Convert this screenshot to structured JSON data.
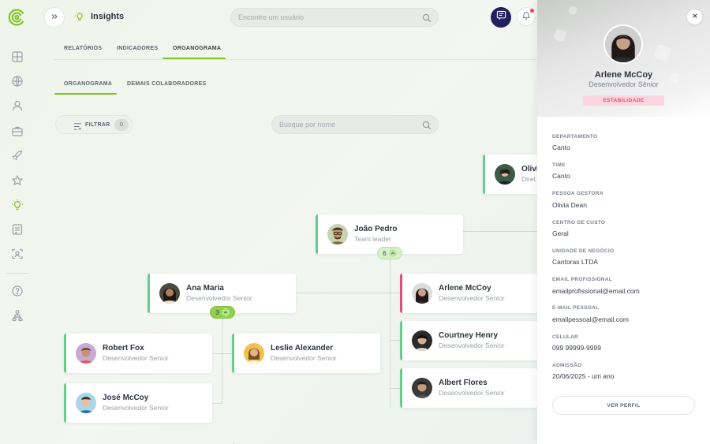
{
  "header": {
    "page_title": "Insights",
    "search_placeholder": "Encontre um usuário"
  },
  "tabs": [
    {
      "label": "RELATÓRIOS"
    },
    {
      "label": "INDICADORES"
    },
    {
      "label": "ORGANOGRAMA"
    }
  ],
  "subtabs": [
    {
      "label": "ORGANOGRAMA"
    },
    {
      "label": "DEMAIS COLABORADORES"
    }
  ],
  "filter": {
    "label": "FILTRAR",
    "count": "0"
  },
  "org_search": {
    "placeholder": "Busque por nome"
  },
  "org_chart": {
    "top": {
      "name": "Olivia",
      "role": "Diret"
    },
    "team_leader": {
      "name": "João Pedro",
      "role": "Team leader",
      "count": "6"
    },
    "ana": {
      "name": "Ana Maria",
      "role": "Desenvolvedor Senior",
      "count": "3"
    },
    "robert": {
      "name": "Robert Fox",
      "role": "Desenvolvedor Senior"
    },
    "leslie": {
      "name": "Leslie Alexander",
      "role": "Desenvolvedor Senior"
    },
    "jose": {
      "name": "José McCoy",
      "role": "Desenvolvedor Senior"
    },
    "arlene": {
      "name": "Arlene McCoy",
      "role": "Desenvolvedor Senior"
    },
    "courtney": {
      "name": "Courtney Henry",
      "role": "Desenvolvedor Senior"
    },
    "albert": {
      "name": "Albert Flores",
      "role": "Desenvolvedor Senior"
    }
  },
  "panel": {
    "name": "Arlene McCoy",
    "role": "Desenvolvedor Sênior",
    "badge": "ESTABILIDADE",
    "fields": [
      {
        "label": "DEPARTAMENTO",
        "value": "Canto"
      },
      {
        "label": "TIME",
        "value": "Canto"
      },
      {
        "label": "PESSOA GESTORA",
        "value": "Olivia Dean"
      },
      {
        "label": "CENTRO DE CUSTO",
        "value": "Geral"
      },
      {
        "label": "UNIDADE DE NEGÓCIO",
        "value": "Cantoras LTDA"
      },
      {
        "label": "EMAIL PROFISSIONAL",
        "value": "emailprofissional@email.com"
      },
      {
        "label": "E-MAIL PESSOAL",
        "value": "emailpessoal@email.com"
      },
      {
        "label": "CELULAR",
        "value": "099 99999-9999"
      },
      {
        "label": "ADMISSÃO",
        "value": "20/06/2025 - um ano"
      }
    ],
    "profile_button": "VER PERFIL"
  },
  "colors": {
    "accent_green": "#84c225",
    "card_border_green": "#64cf8b",
    "card_border_pink": "#e04d77",
    "chat_button": "#22215f",
    "notification_dot": "#f0436b"
  },
  "icons": [
    "logo-icon",
    "dashboard-icon",
    "globe-icon",
    "user-icon",
    "briefcase-icon",
    "rocket-icon",
    "star-icon",
    "lightbulb-icon",
    "document-icon",
    "scan-user-icon",
    "help-icon",
    "network-icon",
    "chevrons-right-icon",
    "search-icon",
    "chat-icon",
    "bell-icon",
    "filter-icon",
    "close-icon"
  ]
}
